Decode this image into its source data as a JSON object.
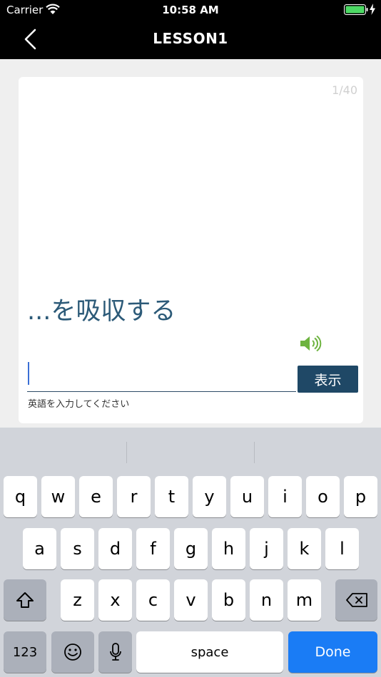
{
  "status_bar": {
    "carrier": "Carrier",
    "time": "10:58 AM",
    "icons": [
      "wifi-icon",
      "battery-icon",
      "charging-bolt-icon"
    ],
    "battery_color": "#4cd964"
  },
  "nav_bar": {
    "back_icon": "chevron-left-icon",
    "title": "LESSON1"
  },
  "card": {
    "counter": "1/40",
    "prompt": "...を吸収する",
    "speaker_icon": "speaker-icon",
    "speaker_color": "#6db33f",
    "input_value": "",
    "show_button_label": "表示",
    "hint": "英語を入力してください",
    "accent_color": "#1f4866"
  },
  "keyboard": {
    "row1": [
      "q",
      "w",
      "e",
      "r",
      "t",
      "y",
      "u",
      "i",
      "o",
      "p"
    ],
    "row2": [
      "a",
      "s",
      "d",
      "f",
      "g",
      "h",
      "j",
      "k",
      "l"
    ],
    "row3": [
      "z",
      "x",
      "c",
      "v",
      "b",
      "n",
      "m"
    ],
    "numbers_label": "123",
    "space_label": "space",
    "done_label": "Done",
    "icons": [
      "shift-icon",
      "backspace-icon",
      "emoji-icon",
      "microphone-icon"
    ],
    "done_color": "#1a7cf5"
  }
}
